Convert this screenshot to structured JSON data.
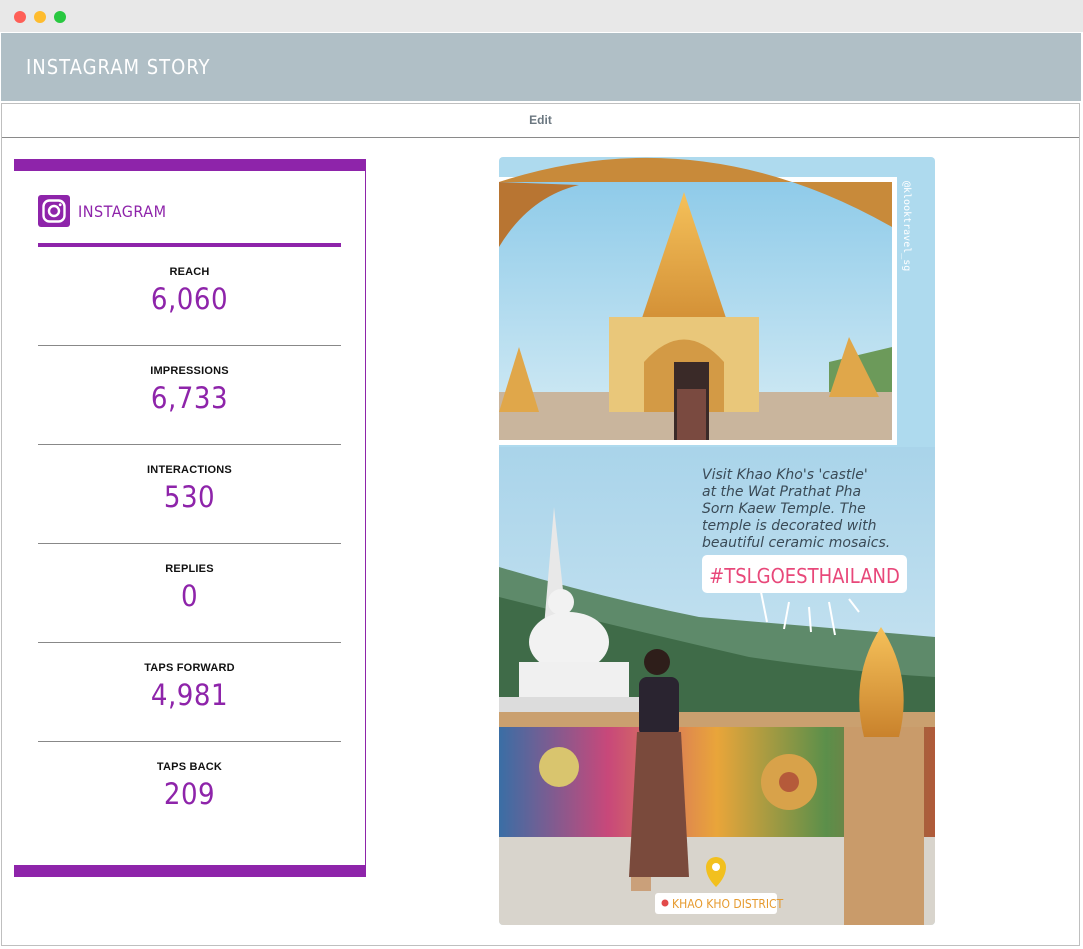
{
  "header": {
    "title": "INSTAGRAM STORY"
  },
  "toolbar": {
    "edit_label": "Edit"
  },
  "card": {
    "brand": "INSTAGRAM",
    "metrics": [
      {
        "label": "REACH",
        "value": "6,060"
      },
      {
        "label": "IMPRESSIONS",
        "value": "6,733"
      },
      {
        "label": "INTERACTIONS",
        "value": "530"
      },
      {
        "label": "REPLIES",
        "value": "0"
      },
      {
        "label": "TAPS FORWARD",
        "value": "4,981"
      },
      {
        "label": "TAPS BACK",
        "value": "209"
      }
    ]
  },
  "story": {
    "handle": "@klooktravel_sg",
    "caption_lines": [
      "Visit Khao Kho's 'castle'",
      "at the Wat Prathat Pha",
      "Sorn Kaew Temple. The",
      "temple is decorated with",
      "beautiful ceramic mosaics."
    ],
    "hashtag": "#TSLGOESTHAILAND",
    "location": "KHAO KHO DISTRICT"
  },
  "colors": {
    "accent": "#8e24aa",
    "header_bg": "#b0bfc6",
    "sky": "#a9d4ea"
  }
}
